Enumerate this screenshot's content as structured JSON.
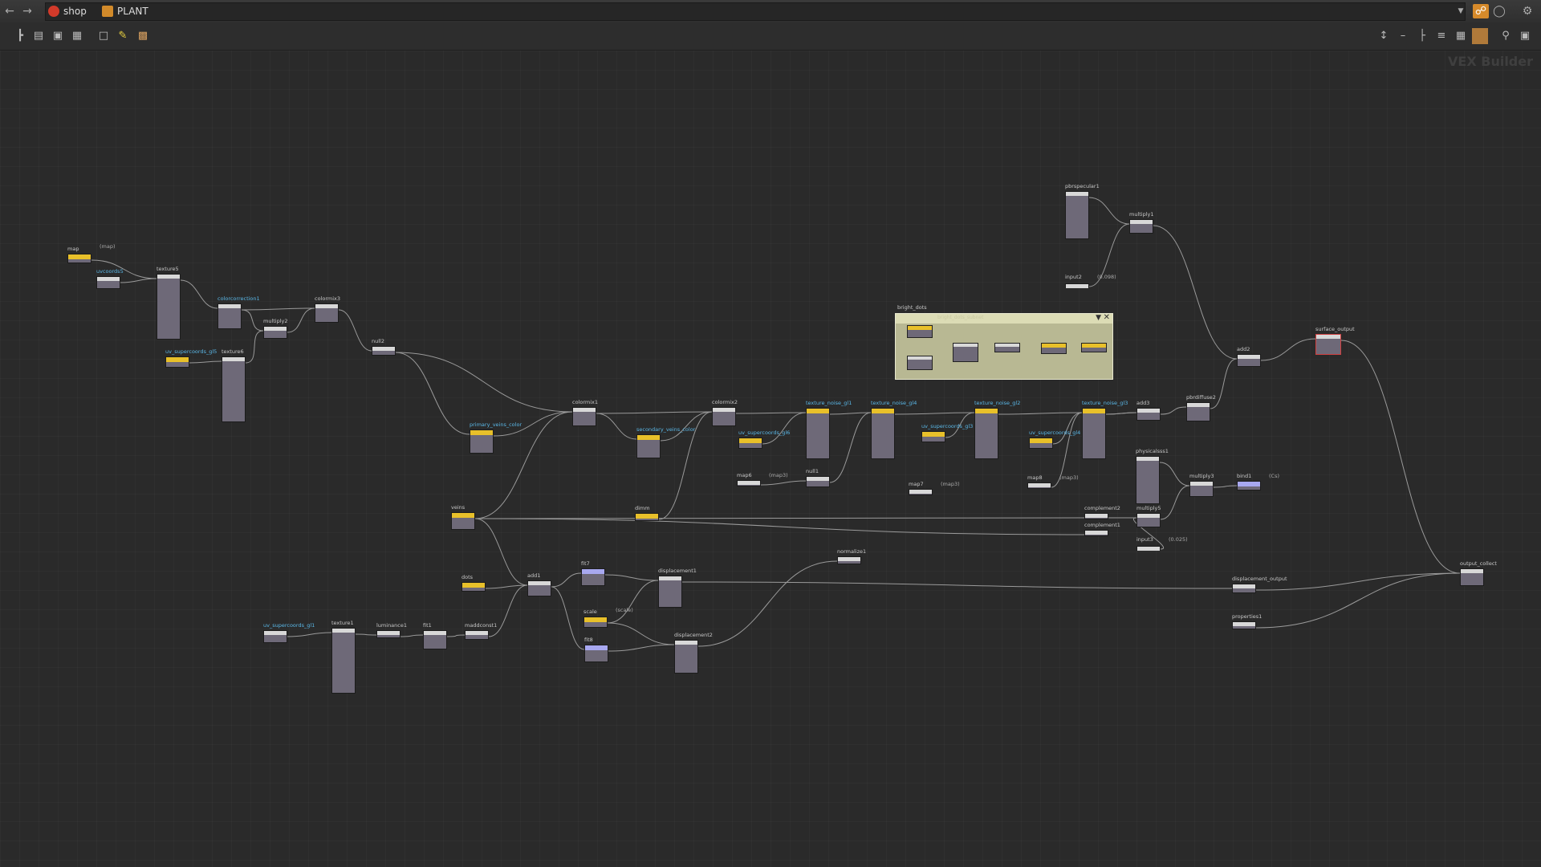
{
  "pathbar": {
    "back_icon": "arrow-left-icon",
    "forward_icon": "arrow-right-icon",
    "crumbs": [
      {
        "label": "shop",
        "icon": "houdini-icon",
        "color": "#d23a2a"
      },
      {
        "label": "PLANT",
        "icon": "vex-builder-icon",
        "color": "#d18a2a"
      }
    ]
  },
  "toolbar": {
    "left_icons": [
      "tree-view-icon",
      "list-view-icon",
      "thumbnail-view-icon",
      "grid-view-icon",
      "network-box-icon",
      "sticky-note-icon",
      "subnet-icon"
    ],
    "right_icons": [
      "layout-icon",
      "flatten-icon",
      "align-icon",
      "wire-style-icon",
      "grid-snap-icon",
      "background-icon",
      "zoom-icon",
      "camera-icon"
    ]
  },
  "network": {
    "context_label": "VEX Builder",
    "netbox_title": "bright_dots",
    "netbox_subtitle": "bright_dots_subnet",
    "nodes": [
      {
        "id": "map",
        "label": "map",
        "cls": "yellow",
        "param": "(map)"
      },
      {
        "id": "uvcoords5",
        "label": "uvcoords5",
        "lc": "cyan"
      },
      {
        "id": "texture5",
        "label": "texture5"
      },
      {
        "id": "colorcorrection1",
        "label": "colorcorrection1",
        "lc": "cyan"
      },
      {
        "id": "multiply2",
        "label": "multiply2"
      },
      {
        "id": "colormix3",
        "label": "colormix3"
      },
      {
        "id": "uv_supercoords_gl5",
        "label": "uv_supercoords_gl5",
        "cls": "yellow",
        "lc": "cyan"
      },
      {
        "id": "texture6",
        "label": "texture6"
      },
      {
        "id": "null2",
        "label": "null2"
      },
      {
        "id": "primary_veins_color",
        "label": "primary_veins_color",
        "cls": "yellow",
        "lc": "cyan"
      },
      {
        "id": "colormix1",
        "label": "colormix1"
      },
      {
        "id": "secondary_veins_color",
        "label": "secondary_veins_color",
        "cls": "yellow",
        "lc": "cyan"
      },
      {
        "id": "colormix2",
        "label": "colormix2"
      },
      {
        "id": "uv_supercoords_gl6",
        "label": "uv_supercoords_gl6",
        "cls": "yellow",
        "lc": "cyan"
      },
      {
        "id": "map6",
        "label": "map6",
        "param": "(map3)"
      },
      {
        "id": "null1",
        "label": "null1"
      },
      {
        "id": "texture_noise_gl1",
        "label": "texture_noise_gl1",
        "cls": "yellow",
        "lc": "cyan"
      },
      {
        "id": "texture_noise_gl4",
        "label": "texture_noise_gl4",
        "cls": "yellow",
        "lc": "cyan"
      },
      {
        "id": "uv_supercoords_gl3",
        "label": "uv_supercoords_gl3",
        "cls": "yellow",
        "lc": "cyan"
      },
      {
        "id": "map7",
        "label": "map7",
        "param": "(map3)"
      },
      {
        "id": "texture_noise_gl2",
        "label": "texture_noise_gl2",
        "cls": "yellow",
        "lc": "cyan"
      },
      {
        "id": "uv_supercoords_gl4",
        "label": "uv_supercoords_gl4",
        "cls": "yellow",
        "lc": "cyan"
      },
      {
        "id": "map8",
        "label": "map8",
        "param": "(map3)"
      },
      {
        "id": "texture_noise_gl3",
        "label": "texture_noise_gl3",
        "cls": "yellow",
        "lc": "cyan"
      },
      {
        "id": "add3",
        "label": "add3"
      },
      {
        "id": "pbrdiffuse2",
        "label": "pbrdiffuse2"
      },
      {
        "id": "pbrspecular1",
        "label": "pbrspecular1"
      },
      {
        "id": "multiply1",
        "label": "multiply1"
      },
      {
        "id": "input2",
        "label": "input2",
        "param": "(0.098)"
      },
      {
        "id": "add2",
        "label": "add2"
      },
      {
        "id": "surface_output",
        "label": "surface_output",
        "cls": "sel"
      },
      {
        "id": "physicalsss1",
        "label": "physicalsss1"
      },
      {
        "id": "multiply3",
        "label": "multiply3"
      },
      {
        "id": "bind1",
        "label": "bind1",
        "cls": "blue",
        "param": "(Cs)"
      },
      {
        "id": "complement2",
        "label": "complement2"
      },
      {
        "id": "multiply5",
        "label": "multiply5"
      },
      {
        "id": "complement1",
        "label": "complement1"
      },
      {
        "id": "input3",
        "label": "input3",
        "param": "(0.025)"
      },
      {
        "id": "veins",
        "label": "veins",
        "cls": "yellow"
      },
      {
        "id": "dimm",
        "label": "dimm",
        "cls": "yellow"
      },
      {
        "id": "dots",
        "label": "dots",
        "cls": "yellow"
      },
      {
        "id": "add1",
        "label": "add1"
      },
      {
        "id": "fit7",
        "label": "fit7",
        "cls": "blue"
      },
      {
        "id": "displacement1",
        "label": "displacement1"
      },
      {
        "id": "normalize1",
        "label": "normalize1"
      },
      {
        "id": "scale",
        "label": "scale",
        "cls": "yellow",
        "param": "(scale)"
      },
      {
        "id": "fit8",
        "label": "fit8",
        "cls": "blue"
      },
      {
        "id": "displacement2",
        "label": "displacement2"
      },
      {
        "id": "uv_supercoords_gl1",
        "label": "uv_supercoords_gl1",
        "lc": "cyan"
      },
      {
        "id": "texture1",
        "label": "texture1"
      },
      {
        "id": "luminance1",
        "label": "luminance1"
      },
      {
        "id": "fit1",
        "label": "fit1"
      },
      {
        "id": "maddconst1",
        "label": "maddconst1"
      },
      {
        "id": "displacement_output",
        "label": "displacement_output"
      },
      {
        "id": "properties1",
        "label": "properties1"
      },
      {
        "id": "output_collect",
        "label": "output_collect"
      }
    ]
  }
}
